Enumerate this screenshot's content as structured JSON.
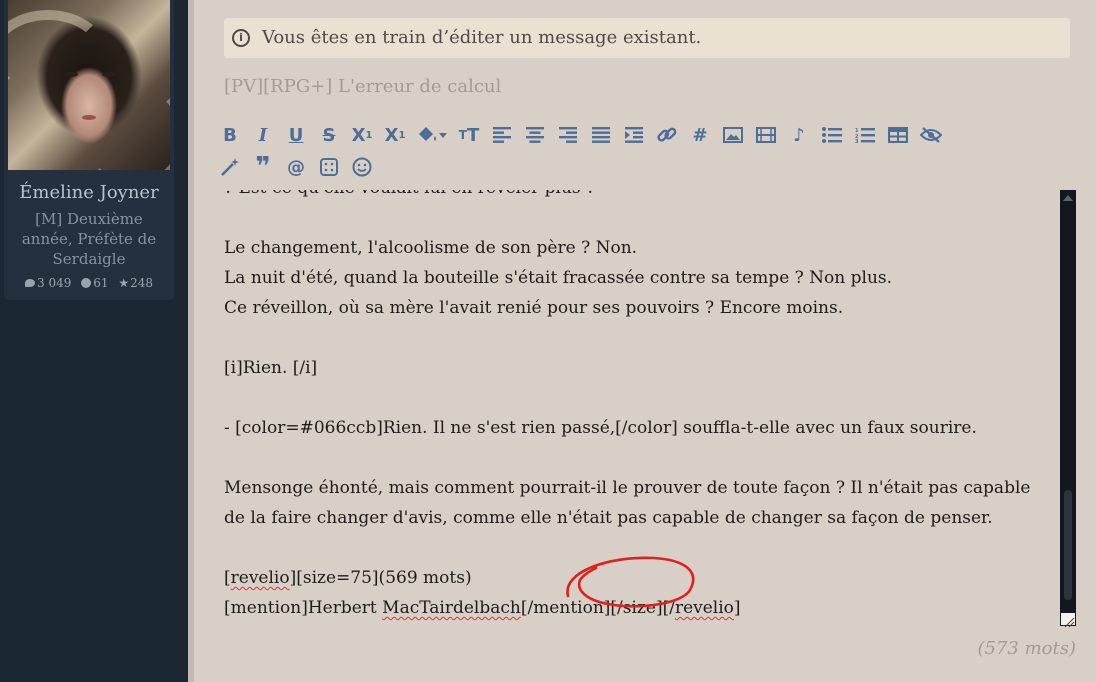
{
  "profile": {
    "name": "Émeline Joyner",
    "description": "[M] Deuxième année, Préfète de Serdaigle",
    "stats": {
      "messages": "3 049",
      "points": "61",
      "stars": "248"
    }
  },
  "editor": {
    "notice": "Vous êtes en train d’éditer un message existant.",
    "subject": "[PV][RPG+] L'erreur de calcul",
    "toolbar_icons": [
      "bold-icon",
      "italic-icon",
      "underline-icon",
      "strikethrough-icon",
      "subscript-icon",
      "superscript-icon",
      "fill-color-icon",
      "font-size-icon",
      "align-left-icon",
      "align-center-icon",
      "align-right-icon",
      "align-justify-icon",
      "indent-icon",
      "link-icon",
      "hashtag-icon",
      "image-icon",
      "video-icon",
      "music-icon",
      "bulleted-list-icon",
      "numbered-list-icon",
      "table-icon",
      "hide-icon",
      "magic-wand-icon",
      "quote-icon",
      "mention-icon",
      "dice-icon",
      "emoji-icon"
    ],
    "body": {
      "line1": "? Est-ce qu'elle voulait lui en révéler plus ?",
      "line2": "",
      "line3": "Le changement, l'alcoolisme de son père ? Non.",
      "line4": "La nuit d'été, quand la bouteille s'était fracassée contre sa tempe ? Non plus.",
      "line5": "Ce réveillon, où sa mère l'avait renié pour ses pouvoirs ? Encore moins.",
      "line6": "",
      "line7": "[i]Rien. [/i]",
      "line8": "",
      "line9": "- [color=#066ccb]Rien. Il ne s'est rien passé,[/color] souffla-t-elle avec un faux sourire.",
      "line10": "",
      "line11": "Mensonge éhonté, mais comment pourrait-il le prouver de toute façon ? Il n'était pas capable",
      "line12": "de la faire changer d'avis, comme elle n'était pas capable de changer sa façon de penser.",
      "line13": "",
      "line14a": "[",
      "line14b": "revelio",
      "line14c": "][size=75](569 mots)",
      "line15a": "[mention]Herbert ",
      "line15b": "MacTairdelbach",
      "line15c": "[/mention][/size][/",
      "line15d": "revelio",
      "line15e": "]"
    },
    "word_count": "(573 mots)"
  },
  "colors": {
    "panel_bg": "#d8cfc6",
    "sidebar_bg": "#1c2734",
    "toolbar_icon": "#4d6e98",
    "annotation_red": "#e0201c"
  }
}
